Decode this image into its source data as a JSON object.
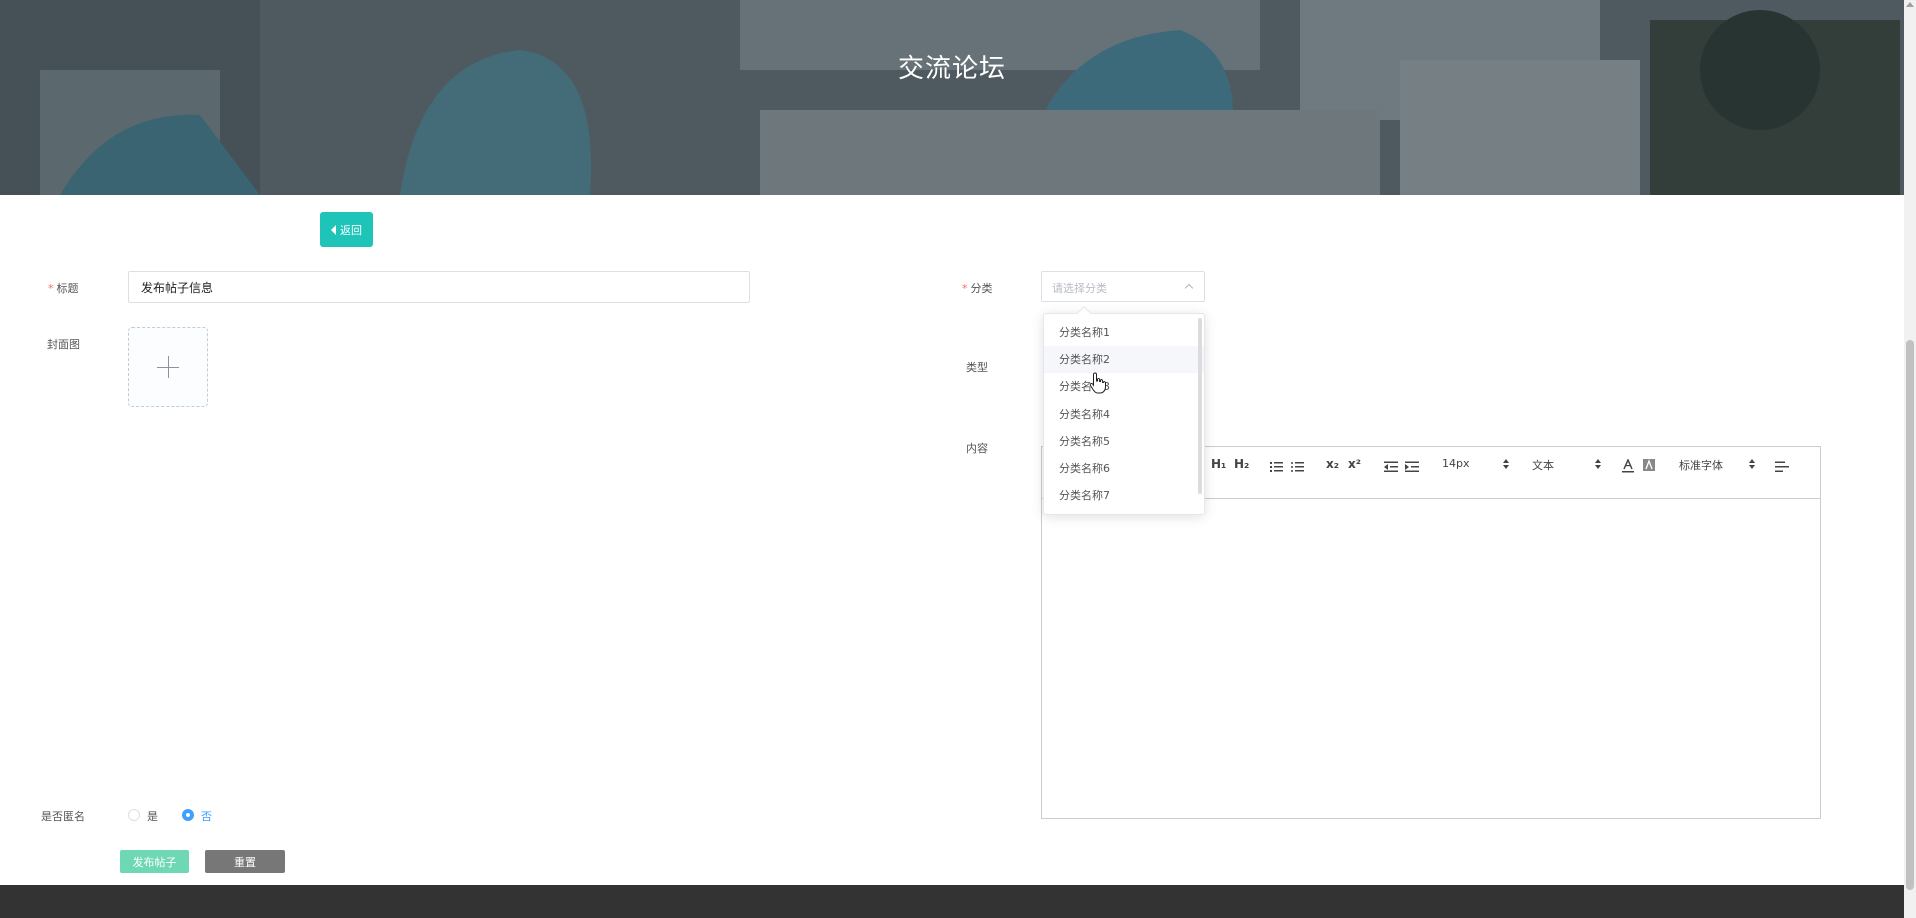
{
  "banner": {
    "title": "交流论坛"
  },
  "back_button": {
    "label": "返回"
  },
  "form": {
    "title": {
      "label": "标题",
      "value": "发布帖子信息"
    },
    "cover": {
      "label": "封面图"
    },
    "category": {
      "label": "分类",
      "placeholder": "请选择分类",
      "expanded": true
    },
    "type": {
      "label": "类型"
    },
    "content": {
      "label": "内容"
    },
    "anonymous": {
      "label": "是否匿名",
      "options": [
        "是",
        "否"
      ],
      "selected": "否"
    }
  },
  "category_options": [
    "分类名称1",
    "分类名称2",
    "分类名称3",
    "分类名称4",
    "分类名称5",
    "分类名称6",
    "分类名称7"
  ],
  "hovered_option": "分类名称2",
  "editor_toolbar": {
    "h1": "H₁",
    "h2": "H₂",
    "subscript": "x₂",
    "superscript": "x²",
    "font_size": "14px",
    "header_select": "文本",
    "font_family": "标准字体",
    "icons": [
      "ordered-list-icon",
      "bullet-list-icon",
      "indent-decrease-icon",
      "indent-increase-icon",
      "font-color-icon",
      "background-color-icon",
      "align-icon"
    ]
  },
  "buttons": {
    "publish": "发布帖子",
    "reset": "重置"
  },
  "colors": {
    "primary": "#1fc4b9",
    "publish": "#6ed7b3",
    "reset": "#777777",
    "required": "#f56c6c",
    "radio_active": "#409eff",
    "footer": "#333333"
  }
}
